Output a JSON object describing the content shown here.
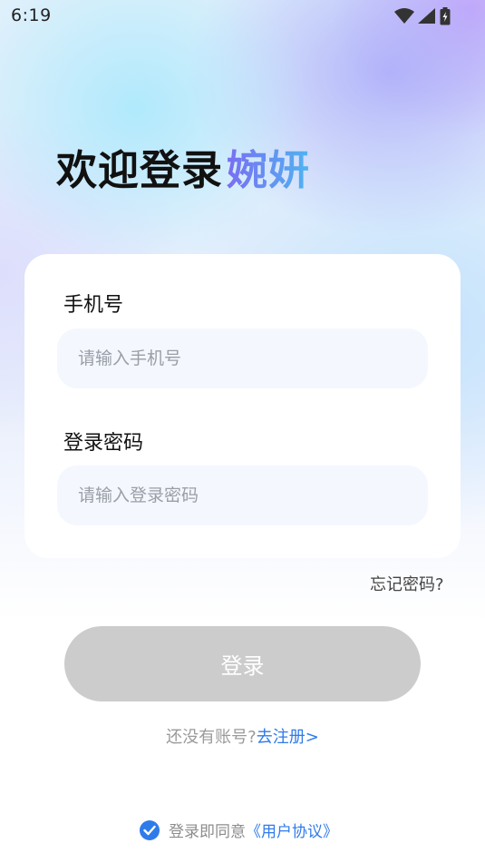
{
  "status_bar": {
    "time": "6:19"
  },
  "headline": {
    "part1": "欢迎登录",
    "part2": "婉妍"
  },
  "form": {
    "phone_label": "手机号",
    "phone_placeholder": "请输入手机号",
    "phone_value": "",
    "password_label": "登录密码",
    "password_placeholder": "请输入登录密码",
    "password_value": "",
    "forgot_label": "忘记密码?"
  },
  "login_button": {
    "label": "登录"
  },
  "register": {
    "question": "还没有账号?",
    "link": "去注册>"
  },
  "agreement": {
    "text": "登录即同意",
    "link": "《用户协议》",
    "checked": true
  },
  "colors": {
    "accent": "#2f7bea",
    "button_disabled": "#cccccc",
    "input_bg": "#f4f7fe"
  }
}
